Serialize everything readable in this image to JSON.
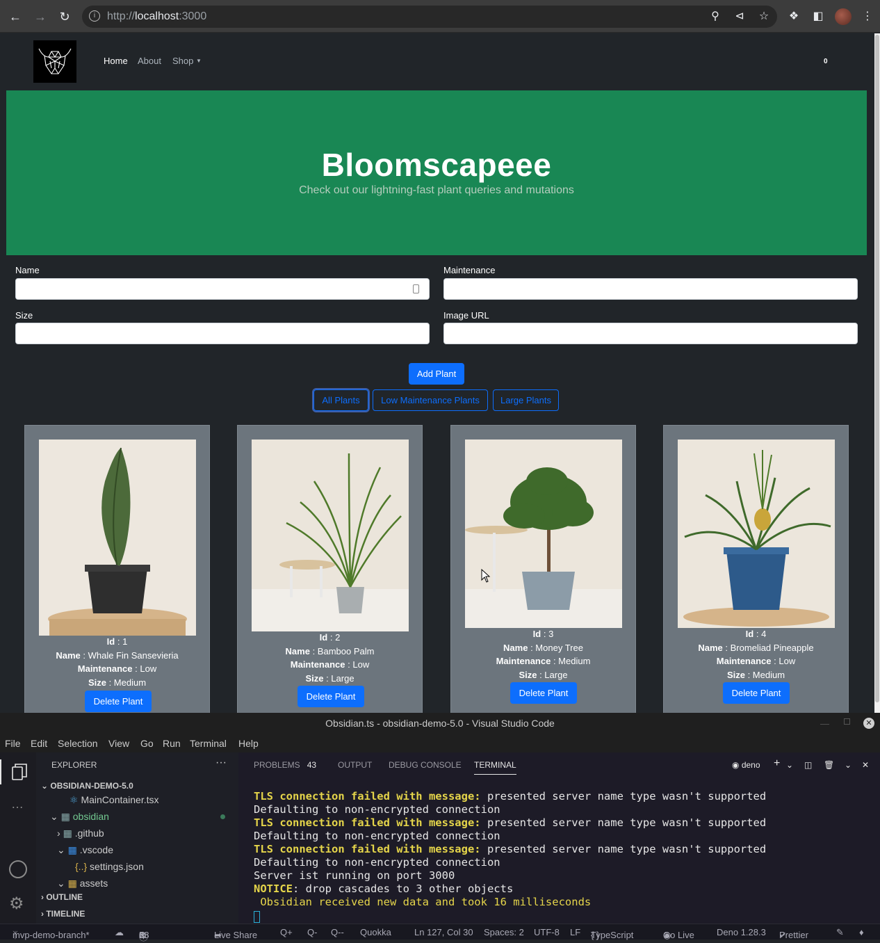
{
  "browser": {
    "url_scheme": "http://",
    "url_host": "localhost",
    "url_port": ":3000"
  },
  "nav": {
    "links": [
      "Home",
      "About",
      "Shop"
    ],
    "cart_count": "0"
  },
  "hero": {
    "title": "Bloomscapeee",
    "subtitle": "Check out our lightning-fast plant queries and mutations"
  },
  "form": {
    "name_label": "Name",
    "maintenance_label": "Maintenance",
    "size_label": "Size",
    "image_url_label": "Image URL",
    "add_button": "Add Plant"
  },
  "filters": [
    "All Plants",
    "Low Maintenance Plants",
    "Large Plants"
  ],
  "field_labels": {
    "id": "Id",
    "name": "Name",
    "maintenance": "Maintenance",
    "size": "Size",
    "sep": " : "
  },
  "plants": [
    {
      "id": "1",
      "name": "Whale Fin Sansevieria",
      "maintenance": "Low",
      "size": "Medium",
      "delete": "Delete Plant"
    },
    {
      "id": "2",
      "name": "Bamboo Palm",
      "maintenance": "Low",
      "size": "Large",
      "delete": "Delete Plant"
    },
    {
      "id": "3",
      "name": "Money Tree",
      "maintenance": "Medium",
      "size": "Large",
      "delete": "Delete Plant"
    },
    {
      "id": "4",
      "name": "Bromeliad Pineapple",
      "maintenance": "Low",
      "size": "Medium",
      "delete": "Delete Plant"
    }
  ],
  "vscode": {
    "title": "Obsidian.ts - obsidian-demo-5.0 - Visual Studio Code",
    "menu": [
      "File",
      "Edit",
      "Selection",
      "View",
      "Go",
      "Run",
      "Terminal",
      "Help"
    ],
    "explorer_title": "EXPLORER",
    "project": "OBSIDIAN-DEMO-5.0",
    "tree": [
      "MainContainer.tsx",
      "obsidian",
      ".github",
      ".vscode",
      "settings.json",
      "assets"
    ],
    "outline": "OUTLINE",
    "timeline": "TIMELINE",
    "panel_tabs": [
      "PROBLEMS",
      "OUTPUT",
      "DEBUG CONSOLE",
      "TERMINAL"
    ],
    "problems_count": "43",
    "shell": "deno",
    "terminal": {
      "tls_label": "TLS connection failed with message:",
      "tls_msg": " presented server name type wasn't supported",
      "fallback": "Defaulting to non-encrypted connection",
      "running": "Server ist running on port 3000",
      "notice_label": "NOTICE",
      "notice_msg": ": drop cascades to 3 other objects",
      "obsidian": " Obsidian received new data and took 16 milliseconds"
    },
    "status": {
      "branch": "mvp-demo-branch*",
      "errors": "0",
      "warnings": "38",
      "infos": "5",
      "live_share": "Live Share",
      "q1": "Q+",
      "q2": "Q-",
      "q3": "Q--",
      "quokka": "Quokka",
      "position": "Ln 127, Col 30",
      "spaces": "Spaces: 2",
      "encoding": "UTF-8",
      "eol": "LF",
      "language": "TypeScript",
      "go_live": "Go Live",
      "deno": "Deno 1.28.3",
      "prettier": "Prettier"
    }
  }
}
